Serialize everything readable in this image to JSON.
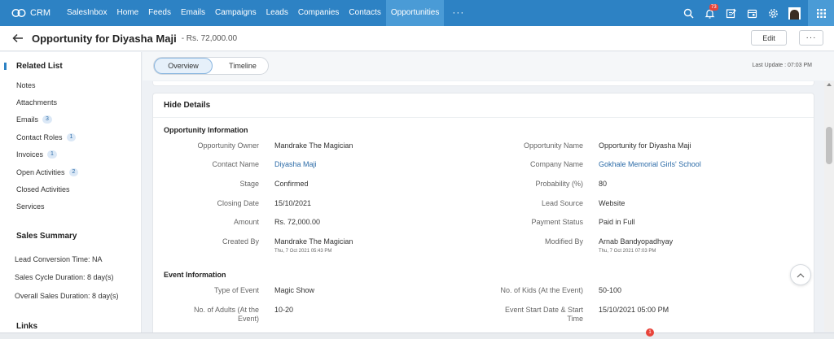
{
  "topnav": {
    "brand": "CRM",
    "items": [
      {
        "label": "SalesInbox"
      },
      {
        "label": "Home"
      },
      {
        "label": "Feeds"
      },
      {
        "label": "Emails"
      },
      {
        "label": "Campaigns"
      },
      {
        "label": "Leads"
      },
      {
        "label": "Companies"
      },
      {
        "label": "Contacts"
      },
      {
        "label": "Opportunities",
        "active": true
      }
    ],
    "more": "···",
    "notification_count": "73"
  },
  "header": {
    "title": "Opportunity for Diyasha Maji",
    "amount": "- Rs. 72,000.00",
    "edit_label": "Edit",
    "more_label": "···"
  },
  "sidebar": {
    "related_list_heading": "Related List",
    "items": [
      {
        "label": "Notes"
      },
      {
        "label": "Attachments"
      },
      {
        "label": "Emails",
        "badge": "3"
      },
      {
        "label": "Contact Roles",
        "badge": "1"
      },
      {
        "label": "Invoices",
        "badge": "1"
      },
      {
        "label": "Open Activities",
        "badge": "2"
      },
      {
        "label": "Closed Activities"
      },
      {
        "label": "Services"
      }
    ],
    "sales_summary_heading": "Sales Summary",
    "stats": [
      {
        "text": "Lead Conversion Time: NA"
      },
      {
        "text": "Sales Cycle Duration: 8 day(s)"
      },
      {
        "text": "Overall Sales Duration: 8 day(s)"
      }
    ],
    "links_heading": "Links"
  },
  "tabs": {
    "overview": "Overview",
    "timeline": "Timeline",
    "last_update": "Last Update : 07:03 PM"
  },
  "details": {
    "hide_details": "Hide Details",
    "opportunity_info_title": "Opportunity Information",
    "fields": {
      "owner": {
        "label": "Opportunity Owner",
        "value": "Mandrake The Magician"
      },
      "opp_name": {
        "label": "Opportunity Name",
        "value": "Opportunity for Diyasha Maji"
      },
      "contact": {
        "label": "Contact Name",
        "value": "Diyasha Maji"
      },
      "company": {
        "label": "Company Name",
        "value": "Gokhale Memorial Girls' School"
      },
      "stage": {
        "label": "Stage",
        "value": "Confirmed"
      },
      "probability": {
        "label": "Probability (%)",
        "value": "80"
      },
      "closing_date": {
        "label": "Closing Date",
        "value": "15/10/2021"
      },
      "lead_source": {
        "label": "Lead Source",
        "value": "Website"
      },
      "amount": {
        "label": "Amount",
        "value": "Rs. 72,000.00"
      },
      "payment_status": {
        "label": "Payment Status",
        "value": "Paid in Full"
      },
      "created_by": {
        "label": "Created By",
        "value": "Mandrake The Magician",
        "sub": "Thu, 7 Oct 2021 05:43 PM"
      },
      "modified_by": {
        "label": "Modified By",
        "value": "Arnab Bandyopadhyay",
        "sub": "Thu, 7 Oct 2021 07:03 PM"
      }
    },
    "event_info_title": "Event Information",
    "event_fields": {
      "event_type": {
        "label": "Type of Event",
        "value": "Magic Show"
      },
      "kids": {
        "label": "No. of Kids (At the Event)",
        "value": "50-100"
      },
      "adults": {
        "label_line1": "No. of Adults (At the",
        "label_line2": "Event)",
        "value": "10-20"
      },
      "start": {
        "label_line1": "Event Start Date & Start",
        "label_line2": "Time",
        "value": "15/10/2021 05:00 PM"
      }
    }
  },
  "bottom": {
    "badge": "1"
  }
}
